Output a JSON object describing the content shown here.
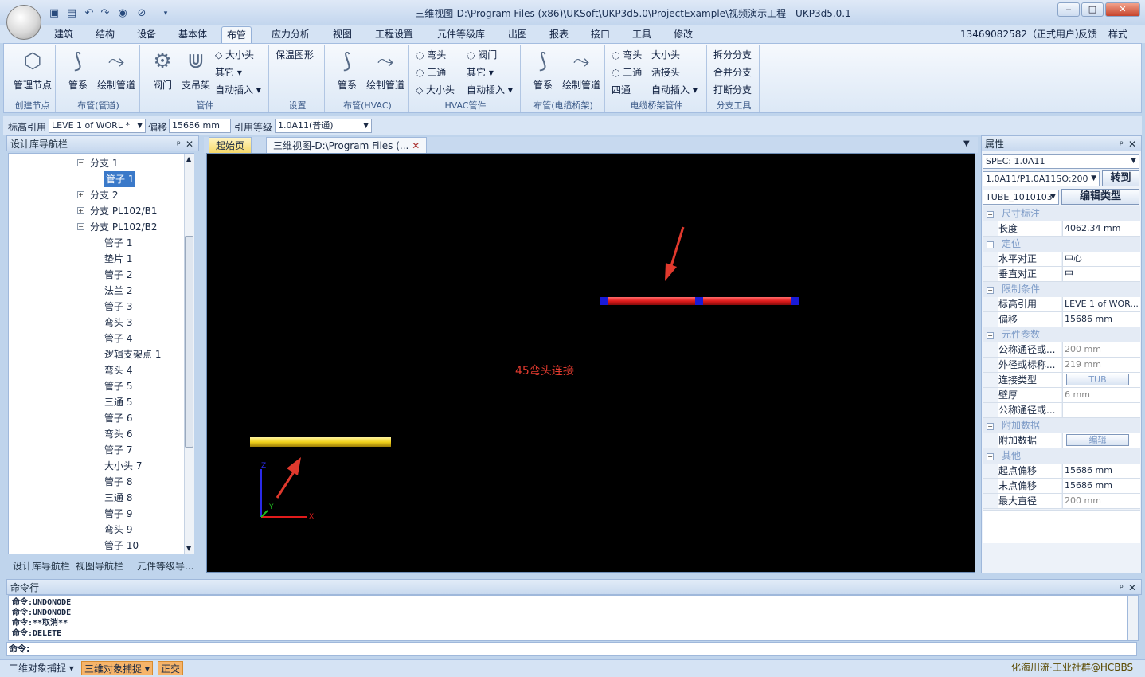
{
  "window": {
    "title": "三维视图-D:\\Program Files (x86)\\UKSoft\\UKP3d5.0\\ProjectExample\\视频演示工程 - UKP3d5.0.1",
    "min": "‒",
    "max": "□",
    "close": "✕"
  },
  "menu": {
    "tabs": [
      "建筑",
      "结构",
      "设备",
      "基本体",
      "布管",
      "应力分析",
      "视图",
      "工程设置",
      "元件等级库",
      "出图",
      "报表",
      "接口",
      "工具",
      "修改"
    ],
    "active": "布管",
    "user": "13469082582（正式用户）",
    "feedback": "反馈",
    "style": "样式"
  },
  "ribbon": {
    "g1": {
      "label": "创建节点",
      "b1": "管理节点"
    },
    "g2": {
      "label": "布管(管道)",
      "b1": "管系",
      "b2": "绘制管道"
    },
    "g3": {
      "label": "管件",
      "b1": "阀门",
      "b2": "支吊架",
      "s1": "大小头",
      "s2": "其它",
      "s3": "自动插入"
    },
    "g4": {
      "label": "设置",
      "b1": "保温图形"
    },
    "g5": {
      "label": "布管(HVAC)",
      "b1": "管系",
      "b2": "绘制管道"
    },
    "g6": {
      "label": "HVAC管件",
      "s1": "弯头",
      "s2": "阀门",
      "s3": "三通",
      "s4": "其它",
      "s5": "大小头",
      "s6": "自动插入"
    },
    "g7": {
      "label": "布管(电缆桥架)",
      "b1": "管系",
      "b2": "绘制管道"
    },
    "g8": {
      "label": "电缆桥架管件",
      "s1": "弯头",
      "s2": "大小头",
      "s3": "三通",
      "s4": "活接头",
      "s5": "四通",
      "s6": "自动插入"
    },
    "g9": {
      "label": "分支工具",
      "s1": "拆分分支",
      "s2": "合并分支",
      "s3": "打断分支"
    }
  },
  "props_bar": {
    "elev_label": "标高引用",
    "elev_value": "LEVE 1 of WORL *",
    "offset_label": "偏移",
    "offset_value": "15686 mm",
    "grade_label": "引用等级",
    "grade_value": "1.0A11(普通)"
  },
  "left_panel": {
    "title": "设计库导航栏",
    "tree": [
      {
        "label": "分支 1",
        "level": 1,
        "exp": "−"
      },
      {
        "label": "管子 1",
        "level": 2,
        "sel": true
      },
      {
        "label": "分支 2",
        "level": 1,
        "exp": "+"
      },
      {
        "label": "分支 PL102/B1",
        "level": 1,
        "exp": "+"
      },
      {
        "label": "分支 PL102/B2",
        "level": 1,
        "exp": "−"
      },
      {
        "label": "管子 1",
        "level": 2
      },
      {
        "label": "垫片 1",
        "level": 2
      },
      {
        "label": "管子 2",
        "level": 2
      },
      {
        "label": "法兰 2",
        "level": 2
      },
      {
        "label": "管子 3",
        "level": 2
      },
      {
        "label": "弯头 3",
        "level": 2
      },
      {
        "label": "管子 4",
        "level": 2
      },
      {
        "label": "逻辑支架点 1",
        "level": 2
      },
      {
        "label": "弯头 4",
        "level": 2
      },
      {
        "label": "管子 5",
        "level": 2
      },
      {
        "label": "三通 5",
        "level": 2
      },
      {
        "label": "管子 6",
        "level": 2
      },
      {
        "label": "弯头 6",
        "level": 2
      },
      {
        "label": "管子 7",
        "level": 2
      },
      {
        "label": "大小头 7",
        "level": 2
      },
      {
        "label": "管子 8",
        "level": 2
      },
      {
        "label": "三通 8",
        "level": 2
      },
      {
        "label": "管子 9",
        "level": 2
      },
      {
        "label": "弯头 9",
        "level": 2
      },
      {
        "label": "管子 10",
        "level": 2
      }
    ],
    "bottom_tabs": [
      "设计库导航栏",
      "视图导航栏",
      "元件等级导..."
    ]
  },
  "doc_tabs": {
    "start": "起始页",
    "view": "三维视图-D:\\Program Files (..."
  },
  "viewport": {
    "annotation": "45弯头连接",
    "axis_x": "X",
    "axis_y": "Y",
    "axis_z": "Z"
  },
  "right_panel": {
    "title": "属性",
    "spec": "SPEC: 1.0A11",
    "spec_path": "1.0A11/P1.0A11SO:200",
    "goto": "转到",
    "tube": "TUBE_1010103",
    "edit_type": "编辑类型",
    "sections": [
      {
        "name": "尺寸标注",
        "rows": [
          {
            "k": "长度",
            "v": "4062.34 mm"
          }
        ]
      },
      {
        "name": "定位",
        "rows": [
          {
            "k": "水平对正",
            "v": "中心"
          },
          {
            "k": "垂直对正",
            "v": "中"
          }
        ]
      },
      {
        "name": "限制条件",
        "rows": [
          {
            "k": "标高引用",
            "v": "LEVE 1 of WOR..."
          },
          {
            "k": "偏移",
            "v": "15686 mm"
          }
        ]
      },
      {
        "name": "元件参数",
        "rows": [
          {
            "k": "公称通径或...",
            "v": "200 mm",
            "dim": true
          },
          {
            "k": "外径或标称...",
            "v": "219 mm",
            "dim": true
          },
          {
            "k": "连接类型",
            "v": "TUB",
            "btn": true
          },
          {
            "k": "壁厚",
            "v": "6 mm",
            "dim": true
          },
          {
            "k": "公称通径或...",
            "v": ""
          }
        ]
      },
      {
        "name": "附加数据",
        "rows": [
          {
            "k": "附加数据",
            "v": "编辑",
            "btn": true
          }
        ]
      },
      {
        "name": "其他",
        "rows": [
          {
            "k": "起点偏移",
            "v": "15686 mm"
          },
          {
            "k": "末点偏移",
            "v": "15686 mm"
          },
          {
            "k": "最大直径",
            "v": "200 mm",
            "dim": true
          }
        ]
      }
    ]
  },
  "command": {
    "title": "命令行",
    "log": [
      "命令:UNDONODE",
      "命令:UNDONODE",
      "命令:**取消**",
      "命令:DELETE"
    ],
    "prompt": "命令:"
  },
  "status": {
    "snap2d": "二维对象捕捉",
    "snap3d": "三维对象捕捉",
    "ortho": "正交",
    "watermark": "化海川流·工业社群@HCBBS"
  },
  "colors": {
    "accent": "#3a79c9",
    "pipe_red": "#e01b1b",
    "pipe_yellow": "#f2d21b",
    "node_blue": "#1a1ad6"
  }
}
